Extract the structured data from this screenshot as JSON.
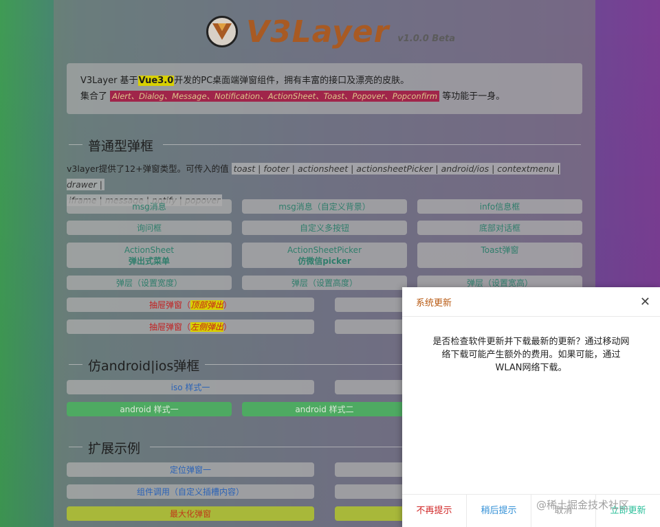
{
  "logo": {
    "title": "V3Layer",
    "version": "v1.0.0 Beta"
  },
  "intro": {
    "line1_prefix": "V3Layer 基于",
    "line1_hl": "Vue3.0",
    "line1_suffix": "开发的PC桌面端弹窗组件，拥有丰富的接口及漂亮的皮肤。",
    "line2_prefix": "集合了 ",
    "line2_tags": "Alert、Dialog、Message、Notification、ActionSheet、Toast、Popover、Popconfirm",
    "line2_suffix": " 等功能于一身。"
  },
  "section1": {
    "title": "普通型弹框",
    "desc_prefix": "v3layer提供了12+弹窗类型。可传入的值 ",
    "desc_types_a": "toast | footer | actionsheet | actionsheetPicker | android/ios | contextmenu | drawer |",
    "desc_types_b": "iframe | message | notify | popover"
  },
  "buttons": {
    "msg": "msg消息",
    "msg_bg": "msg消息（自定义背景）",
    "info": "info信息框",
    "ask": "询问框",
    "custom_btns": "自定义多按钮",
    "bottom_dialog": "底部对话框",
    "actionsheet": "ActionSheet",
    "actionsheet_sub": "弹出式菜单",
    "actionsheetpicker": "ActionSheetPicker",
    "actionsheetpicker_sub": "仿微信picker",
    "toast": "Toast弹窗",
    "width": "弹层（设置宽度）",
    "height": "弹层（设置高度）",
    "wh": "弹层（设置宽高）",
    "drawer_top_a": "抽屉弹窗（",
    "drawer_top_hl": "顶部弹出",
    "drawer_top_b": "）",
    "drawer_left_a": "抽屉弹窗（",
    "drawer_left_hl": "左侧弹出",
    "drawer_left_b": "）",
    "ios1": "iso 样式一",
    "android1": "android 样式一",
    "android2": "android 样式二",
    "pos1": "定位弹窗一",
    "comp": "组件调用（自定义插槽内容）",
    "max": "最大化弹窗"
  },
  "section2": {
    "title": "仿android|ios弹框"
  },
  "section3": {
    "title": "扩展示例"
  },
  "dialog": {
    "title": "系统更新",
    "body": "是否检查软件更新并下载最新的更新？通过移动网络下载可能产生额外的费用。如果可能，通过WLAN网络下载。",
    "buttons": [
      "不再提示",
      "稍后提示",
      "取消",
      "立即更新"
    ],
    "button_colors": [
      "#d02525",
      "#2f8ed6",
      "#999999",
      "#2bbf9a"
    ]
  },
  "watermark": "@稀土掘金技术社区"
}
